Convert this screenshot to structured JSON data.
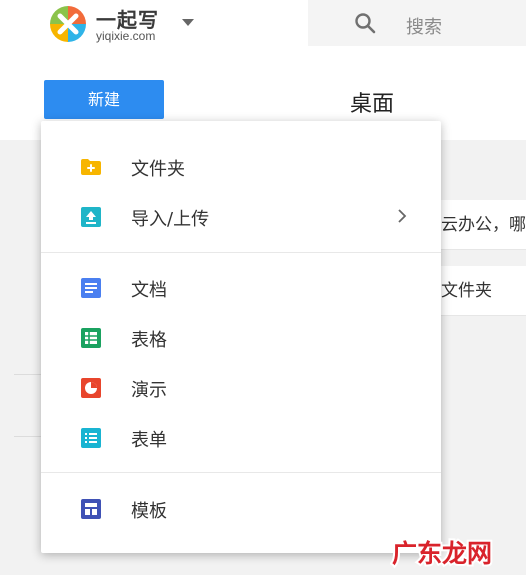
{
  "header": {
    "logo": {
      "name": "一起写",
      "domain": "yiqixie.com"
    },
    "search": {
      "placeholder": "搜索"
    },
    "new_button": "新建",
    "page_title": "桌面"
  },
  "background_rows": [
    {
      "text": "家云办公，哪"
    },
    {
      "text": "作文件夹"
    }
  ],
  "menu": {
    "sections": [
      {
        "items": [
          {
            "label": "文件夹",
            "icon": "folder-add-icon",
            "color": "#f7b500"
          },
          {
            "label": "导入/上传",
            "icon": "upload-icon",
            "color": "#1fb5c8",
            "has_submenu": true
          }
        ]
      },
      {
        "items": [
          {
            "label": "文档",
            "icon": "document-icon",
            "color": "#4a7ff0"
          },
          {
            "label": "表格",
            "icon": "spreadsheet-icon",
            "color": "#1aa260"
          },
          {
            "label": "演示",
            "icon": "presentation-icon",
            "color": "#e8452c"
          },
          {
            "label": "表单",
            "icon": "form-icon",
            "color": "#19b4d2"
          }
        ]
      },
      {
        "items": [
          {
            "label": "模板",
            "icon": "template-icon",
            "color": "#3f51b5"
          }
        ]
      }
    ]
  },
  "colors": {
    "accent": "#2d8cf0",
    "watermark": "#d9232b"
  },
  "watermark": {
    "text": "广东龙网"
  }
}
